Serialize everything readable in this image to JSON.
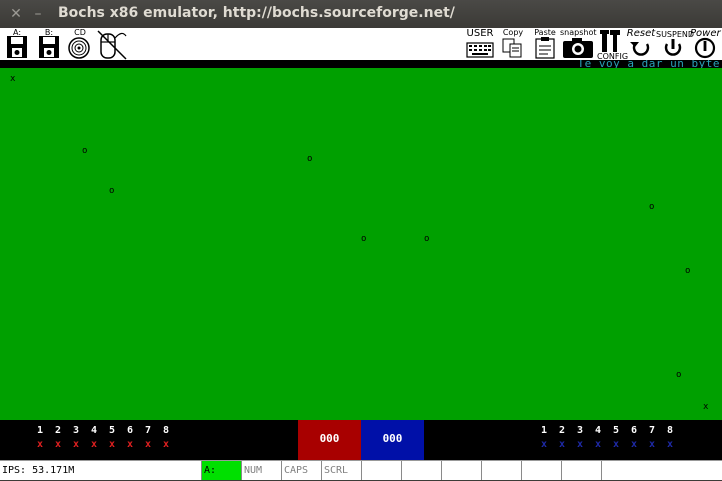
{
  "window": {
    "title": "Bochs x86 emulator, http://bochs.sourceforge.net/",
    "close_glyph": "✕",
    "minimize_glyph": "–"
  },
  "toolbar": {
    "floppy_a": "A:",
    "floppy_b": "B:",
    "cdrom": "CD",
    "user": "USER",
    "copy": "Copy",
    "paste": "Paste",
    "snapshot": "snapshot",
    "config": "CONFIG",
    "reset": "Reset",
    "suspend": "SUSPEND",
    "power": "Power"
  },
  "guest": {
    "status_message": "Te voy a dar un byte",
    "marks": {
      "x_symbol": "x",
      "o_symbol": "o"
    },
    "players_left": {
      "numbers": [
        "1",
        "2",
        "3",
        "4",
        "5",
        "6",
        "7",
        "8"
      ],
      "marks": [
        "x",
        "x",
        "x",
        "x",
        "x",
        "x",
        "x",
        "x"
      ],
      "color": "#e02020"
    },
    "players_right": {
      "numbers": [
        "1",
        "2",
        "3",
        "4",
        "5",
        "6",
        "7",
        "8"
      ],
      "marks": [
        "x",
        "x",
        "x",
        "x",
        "x",
        "x",
        "x",
        "x"
      ],
      "color": "#1e2aa8"
    },
    "score_red": "000",
    "score_blue": "000",
    "colors": {
      "field": "#00a000",
      "score_red_bg": "#a80000",
      "score_blue_bg": "#0010a8"
    }
  },
  "statusbar": {
    "ips": "IPS: 53.171M",
    "drive_a": "A:",
    "num": "NUM",
    "caps": "CAPS",
    "scrl": "SCRL",
    "drive_a_color": "#00e000"
  }
}
